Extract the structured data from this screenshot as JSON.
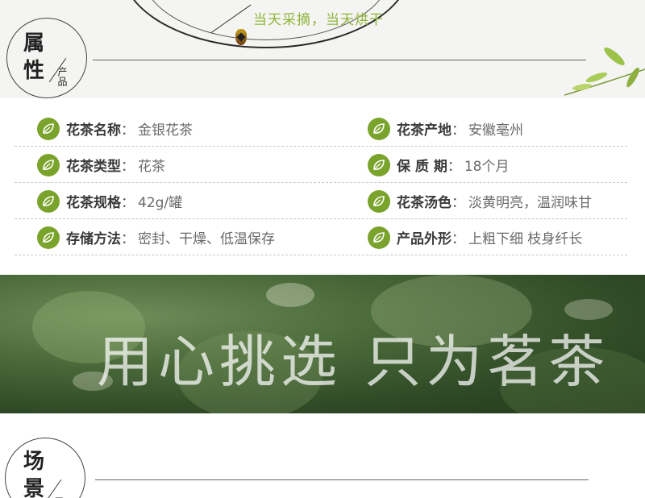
{
  "top_header": {
    "tagline": "当天采摘，当天烘干",
    "badge_main_1": "属",
    "badge_main_2": "性",
    "badge_sub": "产品"
  },
  "attributes": [
    {
      "left": {
        "label": "花茶名称",
        "value": "金银花茶"
      },
      "right": {
        "label": "花茶产地",
        "value": "安徽亳州"
      }
    },
    {
      "left": {
        "label": "花茶类型",
        "value": "花茶"
      },
      "right": {
        "label": "保 质 期",
        "value": "18个月"
      }
    },
    {
      "left": {
        "label": "花茶规格",
        "value": "42g/罐"
      },
      "right": {
        "label": "花茶汤色",
        "value": "淡黄明亮，温润味甘"
      }
    },
    {
      "left": {
        "label": "存储方法",
        "value": "密封、干燥、低温保存"
      },
      "right": {
        "label": "产品外形",
        "value": "上粗下细 枝身纤长"
      }
    }
  ],
  "colon": "：",
  "banner": {
    "slogan": "用心挑选 只为茗茶"
  },
  "bottom_header": {
    "badge_main_1": "场",
    "badge_main_2": "景",
    "badge_sub": "展"
  },
  "colors": {
    "accent_green": "#7aa32c",
    "tagline_green": "#8fb43a"
  },
  "icons": {
    "attribute_icon": "leaf-icon"
  }
}
